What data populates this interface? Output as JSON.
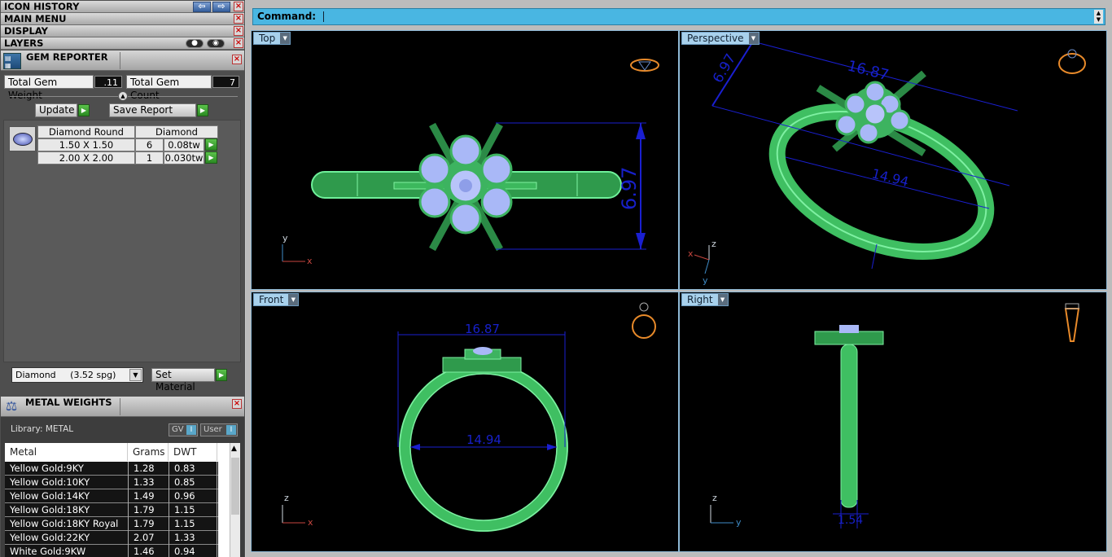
{
  "panel_headers": {
    "icon_history": "ICON HISTORY",
    "main_menu": "MAIN MENU",
    "display": "DISPLAY",
    "layers": "LAYERS"
  },
  "gem_reporter": {
    "title": "GEM REPORTER",
    "total_weight_label": "Total Gem Weight",
    "total_weight_value": ".11",
    "total_count_label": "Total Gem Count",
    "total_count_value": "7",
    "update_label": "Update",
    "save_report_label": "Save Report",
    "table_head": [
      "Diamond Round",
      "Diamond"
    ],
    "rows": [
      {
        "size": "1.50 X 1.50",
        "count": "6",
        "weight": "0.08tw"
      },
      {
        "size": "2.00 X 2.00",
        "count": "1",
        "weight": "0.030tw"
      }
    ],
    "material_select": "Diamond     (3.52 spg)",
    "set_material_label": "Set Material"
  },
  "metal_weights": {
    "title": "METAL WEIGHTS",
    "library": "Library: METAL",
    "gv_label": "GV",
    "user_label": "User",
    "columns": [
      "Metal",
      "Grams",
      "DWT"
    ],
    "rows": [
      {
        "metal": "Yellow Gold:9KY",
        "grams": "1.28",
        "dwt": "0.83"
      },
      {
        "metal": "Yellow Gold:10KY",
        "grams": "1.33",
        "dwt": "0.85"
      },
      {
        "metal": "Yellow Gold:14KY",
        "grams": "1.49",
        "dwt": "0.96"
      },
      {
        "metal": "Yellow Gold:18KY",
        "grams": "1.79",
        "dwt": "1.15"
      },
      {
        "metal": "Yellow Gold:18KY Royal",
        "grams": "1.79",
        "dwt": "1.15"
      },
      {
        "metal": "Yellow Gold:22KY",
        "grams": "2.07",
        "dwt": "1.33"
      },
      {
        "metal": "White Gold:9KW",
        "grams": "1.46",
        "dwt": "0.94"
      }
    ]
  },
  "command": {
    "label": "Command:"
  },
  "viewports": {
    "top": {
      "label": "Top",
      "dim_height": "6.97",
      "axis_a": "y",
      "axis_b": "x"
    },
    "perspective": {
      "label": "Perspective",
      "dim_a": "6.97",
      "dim_b": "16.87",
      "dim_c": "14.94",
      "axis_z": "z",
      "axis_x": "x",
      "axis_y": "y"
    },
    "front": {
      "label": "Front",
      "dim_outer": "16.87",
      "dim_inner": "14.94",
      "axis_a": "z",
      "axis_b": "x"
    },
    "right": {
      "label": "Right",
      "dim_width": "1.54",
      "axis_a": "z",
      "axis_b": "y"
    }
  },
  "colors": {
    "ring_green": "#44d36a",
    "dimension_blue": "#1a1fd0",
    "gem_blue": "#a9b8f7",
    "accent_orange": "#e88a2a",
    "command_bar": "#49b6e2"
  }
}
